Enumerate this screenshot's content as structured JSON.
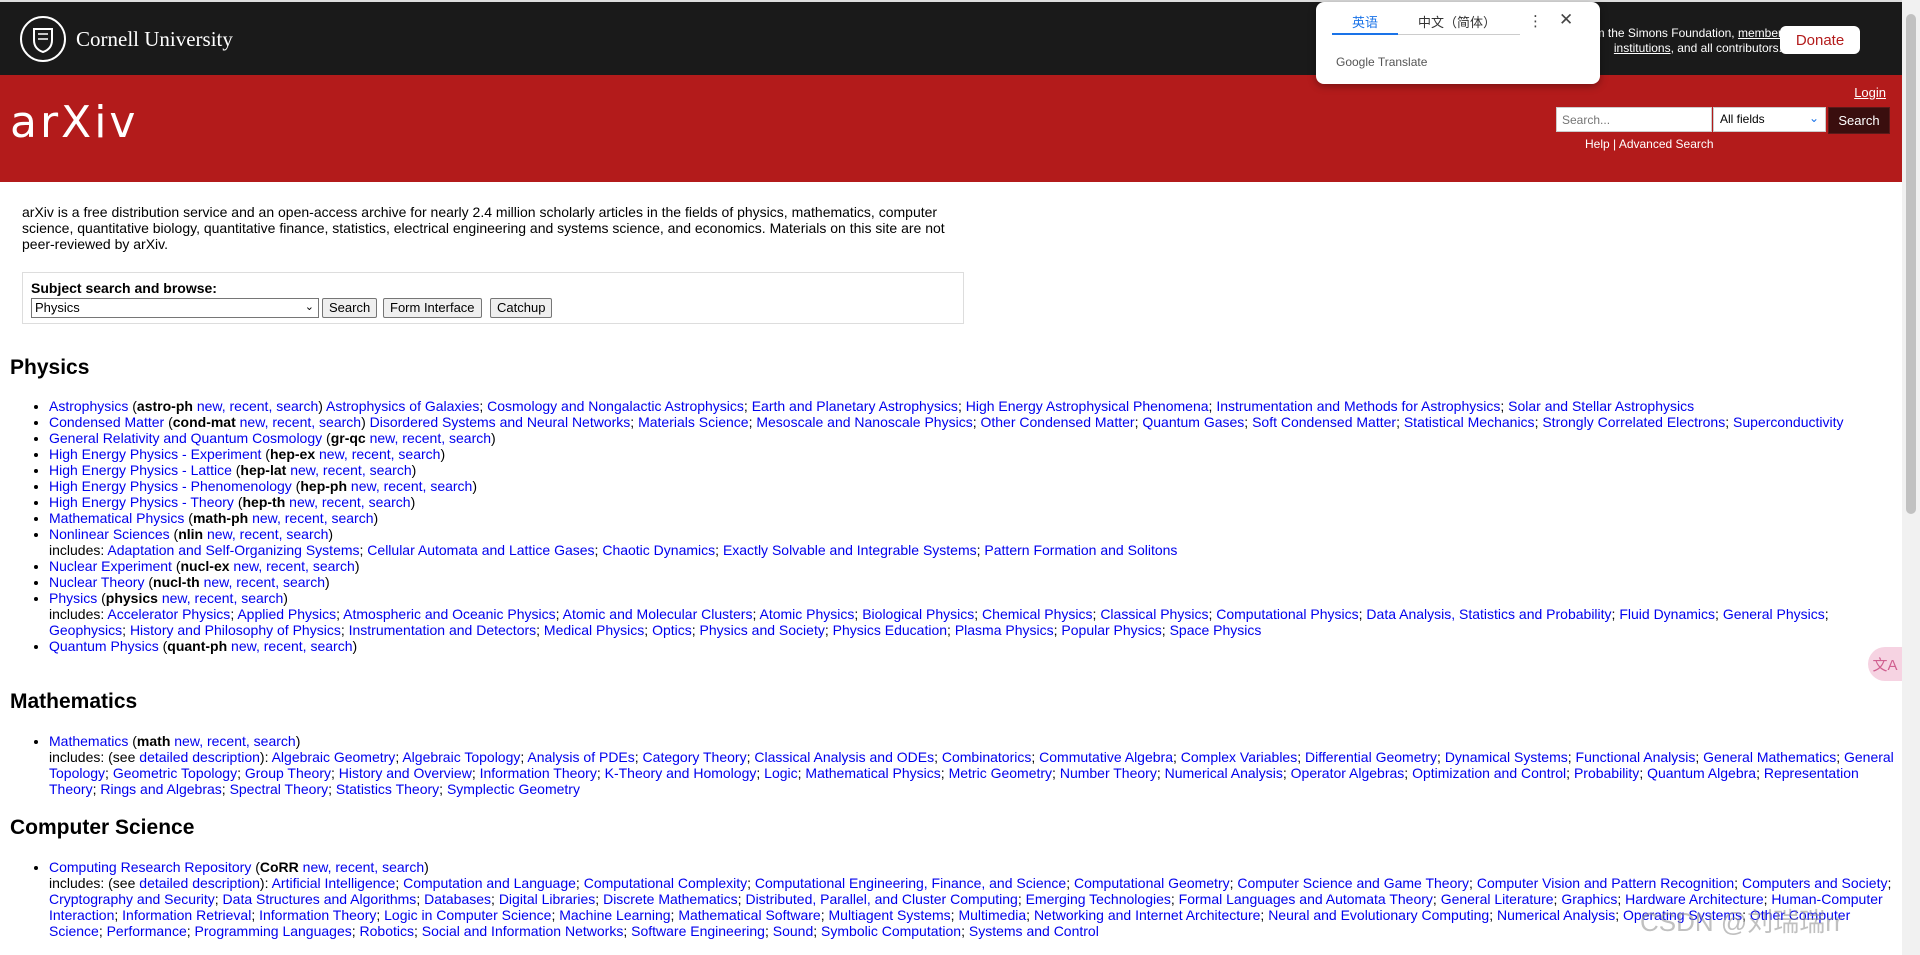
{
  "header": {
    "cornell_name": "Cornell University",
    "ack_text": "om the Simons Foundation,",
    "ack_link1": "member institutions",
    "ack_suffix": ", and all contributors.",
    "donate_label": "Donate"
  },
  "google_translate": {
    "tab_english": "英语",
    "tab_chinese": "中文（简体）",
    "more": "⋮",
    "close": "✕",
    "brand": "Google Translate"
  },
  "arxiv_bar": {
    "logo": "arXiv",
    "login": "Login",
    "search_placeholder": "Search...",
    "field_value": "All fields",
    "search_button": "Search",
    "help_link": "Help",
    "separator": "|",
    "advanced_link": "Advanced Search"
  },
  "intro": "arXiv is a free distribution service and an open-access archive for nearly 2.4 million scholarly articles in the fields of physics, mathematics, computer science, quantitative biology, quantitative finance, statistics, electrical engineering and systems science, and economics. Materials on this site are not peer-reviewed by arXiv.",
  "subject_browse": {
    "label": "Subject search and browse:",
    "selected": "Physics",
    "search_btn": "Search",
    "form_btn": "Form Interface",
    "catchup_btn": "Catchup"
  },
  "sections": {
    "physics_title": "Physics",
    "math_title": "Mathematics",
    "cs_title": "Computer Science"
  },
  "physics_items": [
    {
      "name": "Astrophysics",
      "code": "astro-ph",
      "subs": "Astrophysics of Galaxies; Cosmology and Nongalactic Astrophysics; Earth and Planetary Astrophysics; High Energy Astrophysical Phenomena; Instrumentation and Methods for Astrophysics; Solar and Stellar Astrophysics"
    },
    {
      "name": "Condensed Matter",
      "code": "cond-mat",
      "subs": "Disordered Systems and Neural Networks; Materials Science; Mesoscale and Nanoscale Physics; Other Condensed Matter; Quantum Gases; Soft Condensed Matter; Statistical Mechanics; Strongly Correlated Electrons; Superconductivity"
    },
    {
      "name": "General Relativity and Quantum Cosmology",
      "code": "gr-qc",
      "subs": ""
    },
    {
      "name": "High Energy Physics - Experiment",
      "code": "hep-ex",
      "subs": ""
    },
    {
      "name": "High Energy Physics - Lattice",
      "code": "hep-lat",
      "subs": ""
    },
    {
      "name": "High Energy Physics - Phenomenology",
      "code": "hep-ph",
      "subs": ""
    },
    {
      "name": "High Energy Physics - Theory",
      "code": "hep-th",
      "subs": ""
    },
    {
      "name": "Mathematical Physics",
      "code": "math-ph",
      "subs": ""
    },
    {
      "name": "Nonlinear Sciences",
      "code": "nlin",
      "subs": "",
      "includes": "Adaptation and Self-Organizing Systems; Cellular Automata and Lattice Gases; Chaotic Dynamics; Exactly Solvable and Integrable Systems; Pattern Formation and Solitons"
    },
    {
      "name": "Nuclear Experiment",
      "code": "nucl-ex",
      "subs": ""
    },
    {
      "name": "Nuclear Theory",
      "code": "nucl-th",
      "subs": ""
    },
    {
      "name": "Physics",
      "code": "physics",
      "subs": "",
      "includes": "Accelerator Physics; Applied Physics; Atmospheric and Oceanic Physics; Atomic and Molecular Clusters; Atomic Physics; Biological Physics; Chemical Physics; Classical Physics; Computational Physics; Data Analysis, Statistics and Probability; Fluid Dynamics; General Physics; Geophysics; History and Philosophy of Physics; Instrumentation and Detectors; Medical Physics; Optics; Physics and Society; Physics Education; Plasma Physics; Popular Physics; Space Physics"
    },
    {
      "name": "Quantum Physics",
      "code": "quant-ph",
      "subs": ""
    }
  ],
  "links": {
    "new": "new",
    "recent": "recent",
    "search": "search",
    "includes": "includes:",
    "see": "(see",
    "detailed": "detailed description",
    "close_paren": "):"
  },
  "math_item": {
    "name": "Mathematics",
    "code": "math",
    "includes": "Algebraic Geometry; Algebraic Topology; Analysis of PDEs; Category Theory; Classical Analysis and ODEs; Combinatorics; Commutative Algebra; Complex Variables; Differential Geometry; Dynamical Systems; Functional Analysis; General Mathematics; General Topology; Geometric Topology; Group Theory; History and Overview; Information Theory; K-Theory and Homology; Logic; Mathematical Physics; Metric Geometry; Number Theory; Numerical Analysis; Operator Algebras; Optimization and Control; Probability; Quantum Algebra; Representation Theory; Rings and Algebras; Spectral Theory; Statistics Theory; Symplectic Geometry"
  },
  "cs_item": {
    "name": "Computing Research Repository",
    "code": "CoRR",
    "includes": "Artificial Intelligence; Computation and Language; Computational Complexity; Computational Engineering, Finance, and Science; Computational Geometry; Computer Science and Game Theory; Computer Vision and Pattern Recognition; Computers and Society; Cryptography and Security; Data Structures and Algorithms; Databases; Digital Libraries; Discrete Mathematics; Distributed, Parallel, and Cluster Computing; Emerging Technologies; Formal Languages and Automata Theory; General Literature; Graphics; Hardware Architecture; Human-Computer Interaction; Information Retrieval; Information Theory; Logic in Computer Science; Machine Learning; Mathematical Software; Multiagent Systems; Multimedia; Networking and Internet Architecture; Neural and Evolutionary Computing; Numerical Analysis; Operating Systems; Other Computer Science; Performance; Programming Languages; Robotics; Social and Information Networks; Software Engineering; Sound; Symbolic Computation; Systems and Control"
  },
  "watermark": "CSDN @刘瑞瑞rr",
  "icons": {
    "translate_float": "文A",
    "select_chevron": "⌄"
  }
}
